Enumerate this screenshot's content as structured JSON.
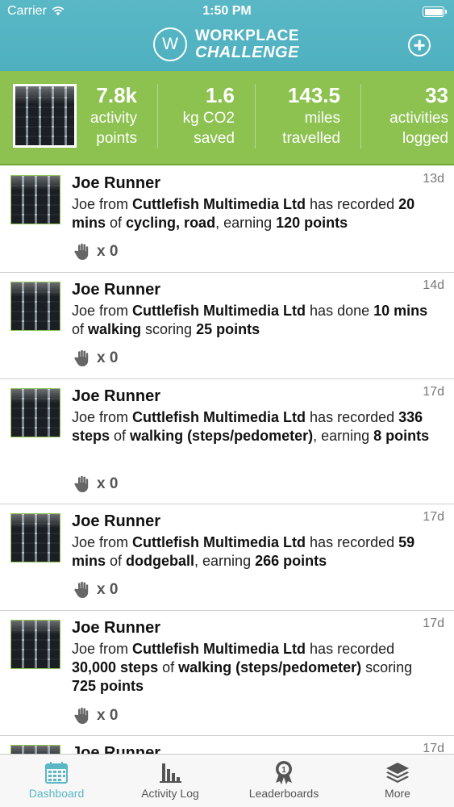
{
  "status_bar": {
    "carrier": "Carrier",
    "time": "1:50 PM"
  },
  "header": {
    "logo_line1": "WORKPLACE",
    "logo_line2": "CHALLENGE",
    "logo_mark": "W"
  },
  "stats": [
    {
      "value": "7.8k",
      "label1": "activity",
      "label2": "points"
    },
    {
      "value": "1.6",
      "label1": "kg CO2",
      "label2": "saved"
    },
    {
      "value": "143.5",
      "label1": "miles",
      "label2": "travelled"
    },
    {
      "value": "33",
      "label1": "activities",
      "label2": "logged"
    }
  ],
  "feed": [
    {
      "name": "Joe Runner",
      "time": "13d",
      "kudos": "x 0",
      "parts": [
        [
          "Joe",
          0
        ],
        [
          " from ",
          0
        ],
        [
          "Cuttlefish Multimedia Ltd",
          1
        ],
        [
          " has recorded ",
          0
        ],
        [
          "20 mins",
          1
        ],
        [
          " of ",
          0
        ],
        [
          "cycling, road",
          1
        ],
        [
          ", earning ",
          0
        ],
        [
          "120 points",
          1
        ]
      ]
    },
    {
      "name": "Joe Runner",
      "time": "14d",
      "kudos": "x 0",
      "parts": [
        [
          "Joe",
          0
        ],
        [
          " from ",
          0
        ],
        [
          "Cuttlefish Multimedia Ltd",
          1
        ],
        [
          " has done ",
          0
        ],
        [
          "10 mins",
          1
        ],
        [
          " of ",
          0
        ],
        [
          "walking",
          1
        ],
        [
          " scoring ",
          0
        ],
        [
          "25 points",
          1
        ]
      ]
    },
    {
      "name": "Joe Runner",
      "time": "17d",
      "kudos": "x 0",
      "parts": [
        [
          "Joe",
          0
        ],
        [
          " from ",
          0
        ],
        [
          "Cuttlefish Multimedia Ltd",
          1
        ],
        [
          " has recorded ",
          0
        ],
        [
          "336 steps",
          1
        ],
        [
          " of ",
          0
        ],
        [
          "walking (steps/pedometer)",
          1
        ],
        [
          ", earning ",
          0
        ],
        [
          "8 points",
          1
        ]
      ]
    },
    {
      "name": "Joe Runner",
      "time": "17d",
      "kudos": "x 0",
      "parts": [
        [
          "Joe",
          0
        ],
        [
          " from ",
          0
        ],
        [
          "Cuttlefish Multimedia Ltd",
          1
        ],
        [
          " has recorded ",
          0
        ],
        [
          "59 mins",
          1
        ],
        [
          " of ",
          0
        ],
        [
          "dodgeball",
          1
        ],
        [
          ", earning ",
          0
        ],
        [
          "266 points",
          1
        ]
      ]
    },
    {
      "name": "Joe Runner",
      "time": "17d",
      "kudos": "x 0",
      "parts": [
        [
          "Joe",
          0
        ],
        [
          " from ",
          0
        ],
        [
          "Cuttlefish Multimedia Ltd",
          1
        ],
        [
          " has recorded ",
          0
        ],
        [
          "30,000 steps",
          1
        ],
        [
          " of ",
          0
        ],
        [
          "walking (steps/pedometer)",
          1
        ],
        [
          " scoring ",
          0
        ],
        [
          "725 points",
          1
        ]
      ]
    },
    {
      "name": "Joe Runner",
      "time": "17d",
      "kudos": "",
      "parts": []
    }
  ],
  "tabs": [
    {
      "label": "Dashboard",
      "icon": "calendar-icon",
      "active": true
    },
    {
      "label": "Activity Log",
      "icon": "bar-chart-icon",
      "active": false
    },
    {
      "label": "Leaderboards",
      "icon": "award-icon",
      "active": false
    },
    {
      "label": "More",
      "icon": "layers-icon",
      "active": false
    }
  ],
  "colors": {
    "header": "#5ab8c6",
    "banner": "#8dc250",
    "tab_active": "#5ab8c6"
  }
}
